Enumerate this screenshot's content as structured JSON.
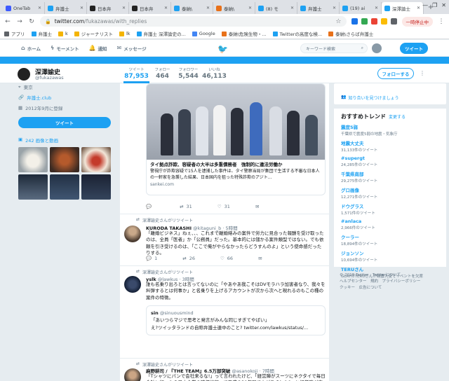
{
  "browser": {
    "tabs": [
      {
        "label": "OneTab",
        "color": "#3d5afe",
        "active": false
      },
      {
        "label": "弁護士",
        "color": "#1da1f2",
        "active": false
      },
      {
        "label": "日本弁",
        "color": "#222222",
        "active": false
      },
      {
        "label": "日本弁",
        "color": "#222222",
        "active": false
      },
      {
        "label": "泰納\\",
        "color": "#1da1f2",
        "active": false
      },
      {
        "label": "泰納\\",
        "color": "#e8711a",
        "active": false
      },
      {
        "label": "(8) モ",
        "color": "#1da1f2",
        "active": false
      },
      {
        "label": "弁護士",
        "color": "#1da1f2",
        "active": false
      },
      {
        "label": "(19) ai",
        "color": "#1da1f2",
        "active": false
      },
      {
        "label": "深澤論士",
        "color": "#1da1f2",
        "active": true
      }
    ],
    "url_host": "twitter.com",
    "url_path": "/fukazawas/with_replies",
    "paused_label": "一時停止中",
    "bookmarks": [
      {
        "label": "アプリ",
        "color": "#5f6368"
      },
      {
        "label": "弁護士",
        "color": "#1da1f2"
      },
      {
        "label": "k",
        "color": "#f4b400"
      },
      {
        "label": "ジャーナリスト",
        "color": "#f4b400"
      },
      {
        "label": "lk",
        "color": "#f4b400"
      },
      {
        "label": "弁護士 深澤論史の...",
        "color": "#1da1f2"
      },
      {
        "label": "Google",
        "color": "#4285f4"
      },
      {
        "label": "泰納\\危険生物・...",
        "color": "#e8711a"
      },
      {
        "label": "Twitterの高度な検...",
        "color": "#1da1f2"
      },
      {
        "label": "泰納\\さらば弁護士",
        "color": "#e8711a"
      }
    ]
  },
  "twitter_nav": {
    "home": "ホーム",
    "moments": "モーメント",
    "notifications": "通知",
    "messages": "メッセージ",
    "search_placeholder": "キーワード検索",
    "tweet_button": "ツイート"
  },
  "profile": {
    "name": "深澤諭史",
    "handle": "@fukazawas",
    "stats": [
      {
        "label": "ツイート",
        "value": "87,953"
      },
      {
        "label": "フォロー",
        "value": "464"
      },
      {
        "label": "フォロワー",
        "value": "5,544"
      },
      {
        "label": "いいね",
        "value": "46,113"
      }
    ],
    "follow_button": "フォローする",
    "location": "東京",
    "website": "弁護士.club",
    "joined": "2012年9月に登録",
    "tweet_button": "ツイート",
    "media_label": "242 画像と動画"
  },
  "timeline": {
    "card": {
      "title": "タイ拠点詐欺、容疑者の大半は多重債務者　強制的に違法労働か",
      "description": "警視庁が詐欺容疑で15人を逮捕した事件は、タイ警察当局が集団で生活する不審な日本人の一軒家を急襲した結果、日本国内を狙った特殊詐欺のアジト...",
      "domain": "sankei.com"
    },
    "card_actions": {
      "replies": "",
      "retweets": "31",
      "likes": "31"
    },
    "tweets": [
      {
        "retweeted_by": "深澤諭史さんがリツイート",
        "name": "KURODA TAKASHI",
        "handle": "@kitaguni_b",
        "time": "5時間",
        "text": "「離婚ビジネス」ねぇ、、、これまで離婚絡みの案件で労力に見合った報酬を受け取ったのは、全員「医者」か「公務員」だった。基本的には儲かる案件類型ではない。でも依頼を引き受けるのは、「ここで俺がやらなかったらどうすんのよ」という使命感だったりする。",
        "replies": "1",
        "retweets": "26",
        "likes": "66"
      },
      {
        "retweeted_by": "深澤諭史さんがリツイート",
        "name": "yslk",
        "handle": "@lawkus",
        "time": "3時間",
        "text": "誰も名乗り出ろとは言ってないのに「やあやあ我こそはDVモラハラ加害者なり、我々を糾弾するとは何事か」と名乗りを上げるアカウントが次から次へと現れるのもこの種の案件の特徴。",
        "quote_name": "sin",
        "quote_handle": "@sinuousmind",
        "quote_line1": "「あいつらマジで思考と発言がみんな同じすぎてやばい」",
        "quote_line2": "え?ツイッタランドの自称弁護士連中のこと? twitter.com/lawkus/status/..."
      },
      {
        "retweeted_by": "深澤諭史さんがリツイート",
        "name": "麻野耕司 / 『THE TEAM』6.5万部突破",
        "handle": "@asanokoji",
        "time": "7時間",
        "text": "「Tシャツにパンで会社来るな!」って言われたけど、「経営陣がスーツにネクタイで毎日会社に行ったら日本企業の時価総額って平成の30年間で上がりました?」と経営陣が言いたい。"
      }
    ]
  },
  "sidebar": {
    "wtf_link": "知り合いを見つけましょう",
    "trends_title": "おすすめトレンド",
    "trends_change": "変更する",
    "trends": [
      {
        "name": "震度5弱",
        "count": "千葉県で震度5弱の地震・気象庁"
      },
      {
        "name": "地震大丈夫",
        "count": "31,133件のツイート"
      },
      {
        "name": "#supergt",
        "count": "24,285件のツイート"
      },
      {
        "name": "千葉県南部",
        "count": "29,275件のツイート"
      },
      {
        "name": "グロ画像",
        "count": "12,271件のツイート"
      },
      {
        "name": "ドウグラス",
        "count": "1,571件のツイート"
      },
      {
        "name": "#anlaca",
        "count": "2,966件のツイート"
      },
      {
        "name": "クーラー",
        "count": "18,894件のツイート"
      },
      {
        "name": "ジョンソン",
        "count": "10,694件のツイート"
      },
      {
        "name": "TERUさん",
        "count": "GLAYのTERUさんが親善大使でイベントを欠席"
      }
    ],
    "footer_line1": "© 2019 Twitter　Twitterについて",
    "footer_line2": "ヘルプセンター　規約　プライバシーポリシー",
    "footer_line3": "クッキー　広告について"
  }
}
